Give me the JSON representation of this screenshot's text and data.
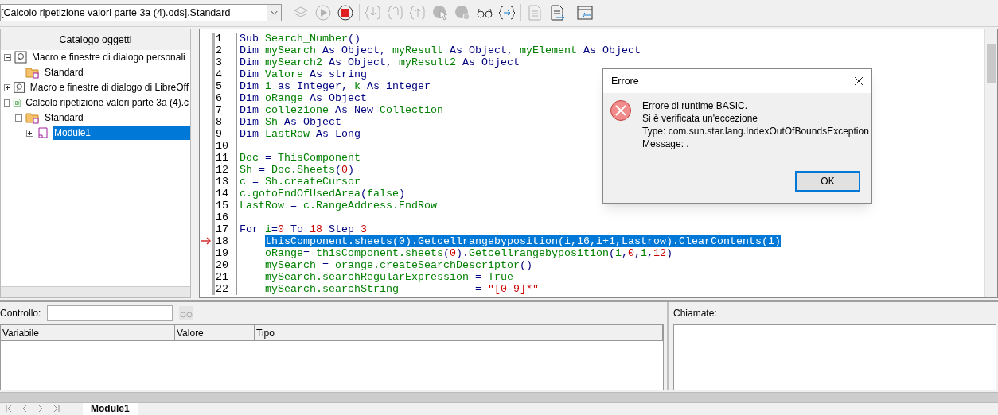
{
  "toolbar": {
    "library_selector": "[Calcolo ripetizione valori parte 3a (4).ods].Standard"
  },
  "catalog": {
    "title": "Catalogo oggetti",
    "tree": [
      {
        "label": "Macro e finestre di dialogo personali",
        "kind": "library",
        "expanded": true,
        "selected": false,
        "children": [
          {
            "label": "Standard",
            "kind": "folder",
            "selected": false
          }
        ]
      },
      {
        "label": "Macro e finestre di dialogo di LibreOff",
        "kind": "library",
        "expanded": false,
        "selected": false
      },
      {
        "label": "Calcolo ripetizione valori parte 3a (4).c",
        "kind": "document",
        "expanded": true,
        "selected": false,
        "children": [
          {
            "label": "Standard",
            "kind": "folder",
            "expanded": true,
            "selected": false,
            "children": [
              {
                "label": "Module1",
                "kind": "module",
                "expanded": false,
                "selected": true
              }
            ]
          }
        ]
      }
    ]
  },
  "editor": {
    "lines": [
      {
        "num": "1",
        "current": false,
        "selected": false,
        "indented": false,
        "tokens": [
          {
            "t": "Sub ",
            "kind": "keyword"
          },
          {
            "t": "Search_Number",
            "kind": "identifier"
          },
          {
            "t": "()",
            "kind": "keyword"
          }
        ]
      },
      {
        "num": "2",
        "current": false,
        "selected": false,
        "indented": false,
        "tokens": [
          {
            "t": "Dim ",
            "kind": "keyword"
          },
          {
            "t": "mySearch",
            "kind": "identifier"
          },
          {
            "t": " As Object, ",
            "kind": "keyword"
          },
          {
            "t": "myResult",
            "kind": "identifier"
          },
          {
            "t": " As Object, ",
            "kind": "keyword"
          },
          {
            "t": "myElement",
            "kind": "identifier"
          },
          {
            "t": " As Object",
            "kind": "keyword"
          }
        ]
      },
      {
        "num": "3",
        "current": false,
        "selected": false,
        "indented": false,
        "tokens": [
          {
            "t": "Dim ",
            "kind": "keyword"
          },
          {
            "t": "mySearch2",
            "kind": "identifier"
          },
          {
            "t": " As Object, ",
            "kind": "keyword"
          },
          {
            "t": "myResult2",
            "kind": "identifier"
          },
          {
            "t": " As Object",
            "kind": "keyword"
          }
        ]
      },
      {
        "num": "4",
        "current": false,
        "selected": false,
        "indented": false,
        "tokens": [
          {
            "t": "Dim ",
            "kind": "keyword"
          },
          {
            "t": "Valore",
            "kind": "identifier"
          },
          {
            "t": " As string",
            "kind": "keyword"
          }
        ]
      },
      {
        "num": "5",
        "current": false,
        "selected": false,
        "indented": false,
        "tokens": [
          {
            "t": "Dim ",
            "kind": "keyword"
          },
          {
            "t": "i",
            "kind": "identifier"
          },
          {
            "t": " as Integer, ",
            "kind": "keyword"
          },
          {
            "t": "k",
            "kind": "identifier"
          },
          {
            "t": " As integer",
            "kind": "keyword"
          }
        ]
      },
      {
        "num": "6",
        "current": false,
        "selected": false,
        "indented": false,
        "tokens": [
          {
            "t": "Dim ",
            "kind": "keyword"
          },
          {
            "t": "oRange",
            "kind": "identifier"
          },
          {
            "t": " As Object",
            "kind": "keyword"
          }
        ]
      },
      {
        "num": "7",
        "current": false,
        "selected": false,
        "indented": false,
        "tokens": [
          {
            "t": "Dim ",
            "kind": "keyword"
          },
          {
            "t": "collezione",
            "kind": "identifier"
          },
          {
            "t": " As New ",
            "kind": "keyword"
          },
          {
            "t": "Collection",
            "kind": "identifier"
          }
        ]
      },
      {
        "num": "8",
        "current": false,
        "selected": false,
        "indented": false,
        "tokens": [
          {
            "t": "Dim ",
            "kind": "keyword"
          },
          {
            "t": "Sh",
            "kind": "identifier"
          },
          {
            "t": " As Object",
            "kind": "keyword"
          }
        ]
      },
      {
        "num": "9",
        "current": false,
        "selected": false,
        "indented": false,
        "tokens": [
          {
            "t": "Dim ",
            "kind": "keyword"
          },
          {
            "t": "LastRow",
            "kind": "identifier"
          },
          {
            "t": " As Long",
            "kind": "keyword"
          }
        ]
      },
      {
        "num": "10",
        "current": false,
        "selected": false
      },
      {
        "num": "11",
        "current": false,
        "selected": false,
        "indented": false,
        "tokens": [
          {
            "t": "Doc",
            "kind": "identifier"
          },
          {
            "t": " = ",
            "kind": "keyword"
          },
          {
            "t": "ThisComponent",
            "kind": "identifier"
          }
        ]
      },
      {
        "num": "12",
        "current": false,
        "selected": false,
        "indented": false,
        "tokens": [
          {
            "t": "Sh",
            "kind": "identifier"
          },
          {
            "t": " = ",
            "kind": "keyword"
          },
          {
            "t": "Doc.Sheets",
            "kind": "identifier"
          },
          {
            "t": "(",
            "kind": "keyword"
          },
          {
            "t": "0",
            "kind": "number"
          },
          {
            "t": ")",
            "kind": "keyword"
          }
        ]
      },
      {
        "num": "13",
        "current": false,
        "selected": false,
        "indented": false,
        "tokens": [
          {
            "t": "c",
            "kind": "identifier"
          },
          {
            "t": " = ",
            "kind": "keyword"
          },
          {
            "t": "Sh.createCursor",
            "kind": "identifier"
          }
        ]
      },
      {
        "num": "14",
        "current": false,
        "selected": false,
        "indented": false,
        "tokens": [
          {
            "t": "c.gotoEndOfUsedArea",
            "kind": "identifier"
          },
          {
            "t": "(",
            "kind": "keyword"
          },
          {
            "t": "false",
            "kind": "identifier"
          },
          {
            "t": ")",
            "kind": "keyword"
          }
        ]
      },
      {
        "num": "15",
        "current": false,
        "selected": false,
        "indented": false,
        "tokens": [
          {
            "t": "LastRow",
            "kind": "identifier"
          },
          {
            "t": " = ",
            "kind": "keyword"
          },
          {
            "t": "c.RangeAddress.EndRow",
            "kind": "identifier"
          }
        ]
      },
      {
        "num": "16",
        "current": false,
        "selected": false
      },
      {
        "num": "17",
        "current": false,
        "selected": false,
        "indented": false,
        "tokens": [
          {
            "t": "For ",
            "kind": "keyword"
          },
          {
            "t": "i",
            "kind": "identifier"
          },
          {
            "t": "=",
            "kind": "keyword"
          },
          {
            "t": "0",
            "kind": "number"
          },
          {
            "t": " To ",
            "kind": "keyword"
          },
          {
            "t": "18",
            "kind": "number"
          },
          {
            "t": " Step ",
            "kind": "keyword"
          },
          {
            "t": "3",
            "kind": "number"
          }
        ]
      },
      {
        "num": "18",
        "current": true,
        "selected": true,
        "indented": true,
        "tokens": [
          {
            "t": "thisComponent.sheets",
            "kind": "identifier"
          },
          {
            "t": "(",
            "kind": "keyword"
          },
          {
            "t": "0",
            "kind": "number"
          },
          {
            "t": ").",
            "kind": "keyword"
          },
          {
            "t": "Getcellrangebyposition",
            "kind": "identifier"
          },
          {
            "t": "(",
            "kind": "keyword"
          },
          {
            "t": "i",
            "kind": "identifier"
          },
          {
            "t": ",",
            "kind": "keyword"
          },
          {
            "t": "16",
            "kind": "number"
          },
          {
            "t": ",",
            "kind": "keyword"
          },
          {
            "t": "i",
            "kind": "identifier"
          },
          {
            "t": "+",
            "kind": "keyword"
          },
          {
            "t": "1",
            "kind": "number"
          },
          {
            "t": ",",
            "kind": "keyword"
          },
          {
            "t": "Lastrow",
            "kind": "identifier"
          },
          {
            "t": ").",
            "kind": "keyword"
          },
          {
            "t": "ClearContents",
            "kind": "identifier"
          },
          {
            "t": "(",
            "kind": "keyword"
          },
          {
            "t": "1",
            "kind": "number"
          },
          {
            "t": ")",
            "kind": "keyword"
          }
        ]
      },
      {
        "num": "19",
        "current": false,
        "selected": false,
        "indented": true,
        "tokens": [
          {
            "t": "oRange",
            "kind": "identifier"
          },
          {
            "t": "= ",
            "kind": "keyword"
          },
          {
            "t": "thisComponent.sheets",
            "kind": "identifier"
          },
          {
            "t": "(",
            "kind": "keyword"
          },
          {
            "t": "0",
            "kind": "number"
          },
          {
            "t": ").",
            "kind": "keyword"
          },
          {
            "t": "Getcellrangebyposition",
            "kind": "identifier"
          },
          {
            "t": "(",
            "kind": "keyword"
          },
          {
            "t": "i",
            "kind": "identifier"
          },
          {
            "t": ",",
            "kind": "keyword"
          },
          {
            "t": "0",
            "kind": "number"
          },
          {
            "t": ",",
            "kind": "keyword"
          },
          {
            "t": "i",
            "kind": "identifier"
          },
          {
            "t": ",",
            "kind": "keyword"
          },
          {
            "t": "12",
            "kind": "number"
          },
          {
            "t": ")",
            "kind": "keyword"
          }
        ]
      },
      {
        "num": "20",
        "current": false,
        "selected": false,
        "indented": true,
        "tokens": [
          {
            "t": "mySearch",
            "kind": "identifier"
          },
          {
            "t": " = ",
            "kind": "keyword"
          },
          {
            "t": "orange.createSearchDescriptor",
            "kind": "identifier"
          },
          {
            "t": "()",
            "kind": "keyword"
          }
        ]
      },
      {
        "num": "21",
        "current": false,
        "selected": false,
        "indented": true,
        "tokens": [
          {
            "t": "mySearch.searchRegularExpression",
            "kind": "identifier"
          },
          {
            "t": " = ",
            "kind": "keyword"
          },
          {
            "t": "True",
            "kind": "identifier"
          }
        ]
      },
      {
        "num": "22",
        "current": false,
        "selected": false,
        "indented": true,
        "tokens": [
          {
            "t": "mySearch.searchString",
            "kind": "identifier"
          },
          {
            "t": "            = ",
            "kind": "keyword"
          },
          {
            "t": "\"[0-9]*\"",
            "kind": "string"
          }
        ]
      }
    ]
  },
  "dialog": {
    "title": "Errore",
    "lines": [
      "Errore di runtime BASIC.",
      "Si è verificata un'eccezione",
      "Type: com.sun.star.lang.IndexOutOfBoundsException",
      "Message: ."
    ],
    "button": "OK"
  },
  "watch": {
    "label": "Controllo:",
    "columns": [
      "Variabile",
      "Valore",
      "Tipo"
    ]
  },
  "calls": {
    "label": "Chiamate:"
  },
  "sheet_tabs": [
    {
      "label": "Module1",
      "selected": true
    }
  ]
}
